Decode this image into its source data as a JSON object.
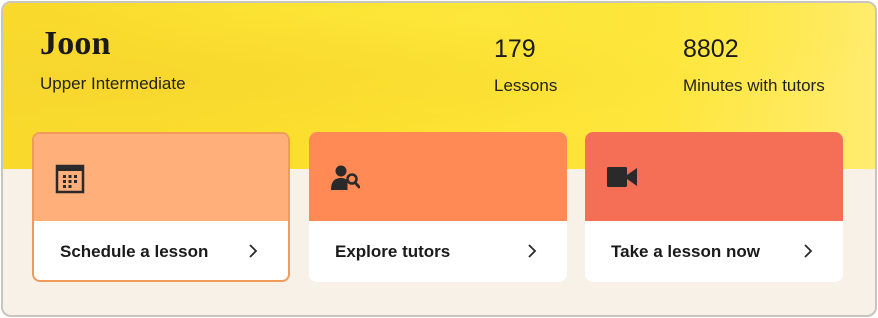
{
  "profile": {
    "name": "Joon",
    "level": "Upper Intermediate"
  },
  "stats": [
    {
      "value": "179",
      "label": "Lessons"
    },
    {
      "value": "8802",
      "label": "Minutes with tutors"
    }
  ],
  "actions": [
    {
      "label": "Schedule a lesson",
      "icon": "calendar-icon",
      "color": "#ffaf7a",
      "selected": true
    },
    {
      "label": "Explore tutors",
      "icon": "tutor-search-icon",
      "color": "#ff8a55"
    },
    {
      "label": "Take a lesson now",
      "icon": "video-camera-icon",
      "color": "#f46f56"
    }
  ],
  "colors": {
    "hero_yellow": "#fde12e",
    "panel_background": "#f8f1e8",
    "selected_border": "#f09a5c"
  }
}
